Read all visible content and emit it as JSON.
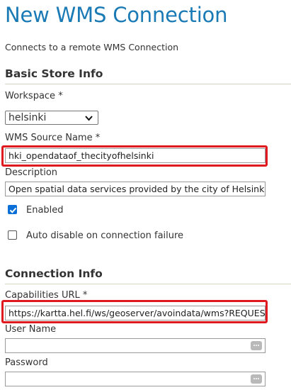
{
  "page": {
    "title": "New WMS Connection",
    "subtitle": "Connects to a remote WMS Connection"
  },
  "basic": {
    "heading": "Basic Store Info",
    "workspace_label": "Workspace *",
    "workspace_value": "helsinki",
    "source_name_label": "WMS Source Name *",
    "source_name_value": "hki_opendataof_thecityofhelsinki",
    "description_label": "Description",
    "description_value": "Open spatial data services provided by the city of Helsinki",
    "enabled_label": "Enabled",
    "enabled_checked": true,
    "auto_disable_label": "Auto disable on connection failure",
    "auto_disable_checked": false
  },
  "connection": {
    "heading": "Connection Info",
    "capabilities_label": "Capabilities URL *",
    "capabilities_value": "https://kartta.hel.fi/ws/geoserver/avoindata/wms?REQUEST=GetCapabilities",
    "username_label": "User Name",
    "username_value": "",
    "password_label": "Password",
    "password_value": ""
  },
  "icons": {
    "select_arrow": "chevron-down-icon",
    "password_manager": "password-dots-icon",
    "checkbox_check": "checkmark-icon"
  },
  "colors": {
    "title": "#1a7ab5",
    "highlight": "#e0191f",
    "checkbox": "#0a6fd6"
  }
}
